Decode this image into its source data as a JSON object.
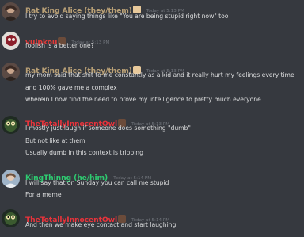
{
  "messages": [
    {
      "author": "Rat King Alice (they/them)",
      "author_color": "#b9a076",
      "badge": "scroll",
      "timestamp": "Today at 5:13 PM",
      "lines": [
        "I try to avoid saying things like \"You are being stupid right now\" too"
      ]
    },
    {
      "author": "vulpkou",
      "author_color": "#e03a3a",
      "badge": "character",
      "timestamp": "Today at 5:13 PM",
      "lines": [
        "foolish is a better one?"
      ]
    },
    {
      "author": "Rat King Alice (they/them)",
      "author_color": "#b9a076",
      "badge": "scroll",
      "timestamp": "Today at 5:13 PM",
      "lines": [
        "my mom said that shit to me constantly as a kid and it really hurt my feelings every time",
        "and 100% gave me a complex",
        "wherein I now find the need to prove my intelligence to pretty much everyone"
      ]
    },
    {
      "author": "TheTotallyInnocentOwl",
      "author_color": "#e8333b",
      "badge": "character",
      "timestamp": "Today at 5:13 PM",
      "lines": [
        "I mostly just laugh if someone does something \"dumb\"",
        "But not like at them",
        "Usually dumb in this context is tripping"
      ]
    },
    {
      "author": "KingThinng (he/him)",
      "author_color": "#2ecc71",
      "badge": "",
      "timestamp": "Today at 5:14 PM",
      "lines": [
        "I will say that on Sunday you can call me stupid",
        "For a meme"
      ]
    },
    {
      "author": "TheTotallyInnocentOwl",
      "author_color": "#e8333b",
      "badge": "character",
      "timestamp": "Today at 5:14 PM",
      "lines": [
        "And then we make eye contact and start laughing"
      ]
    }
  ]
}
